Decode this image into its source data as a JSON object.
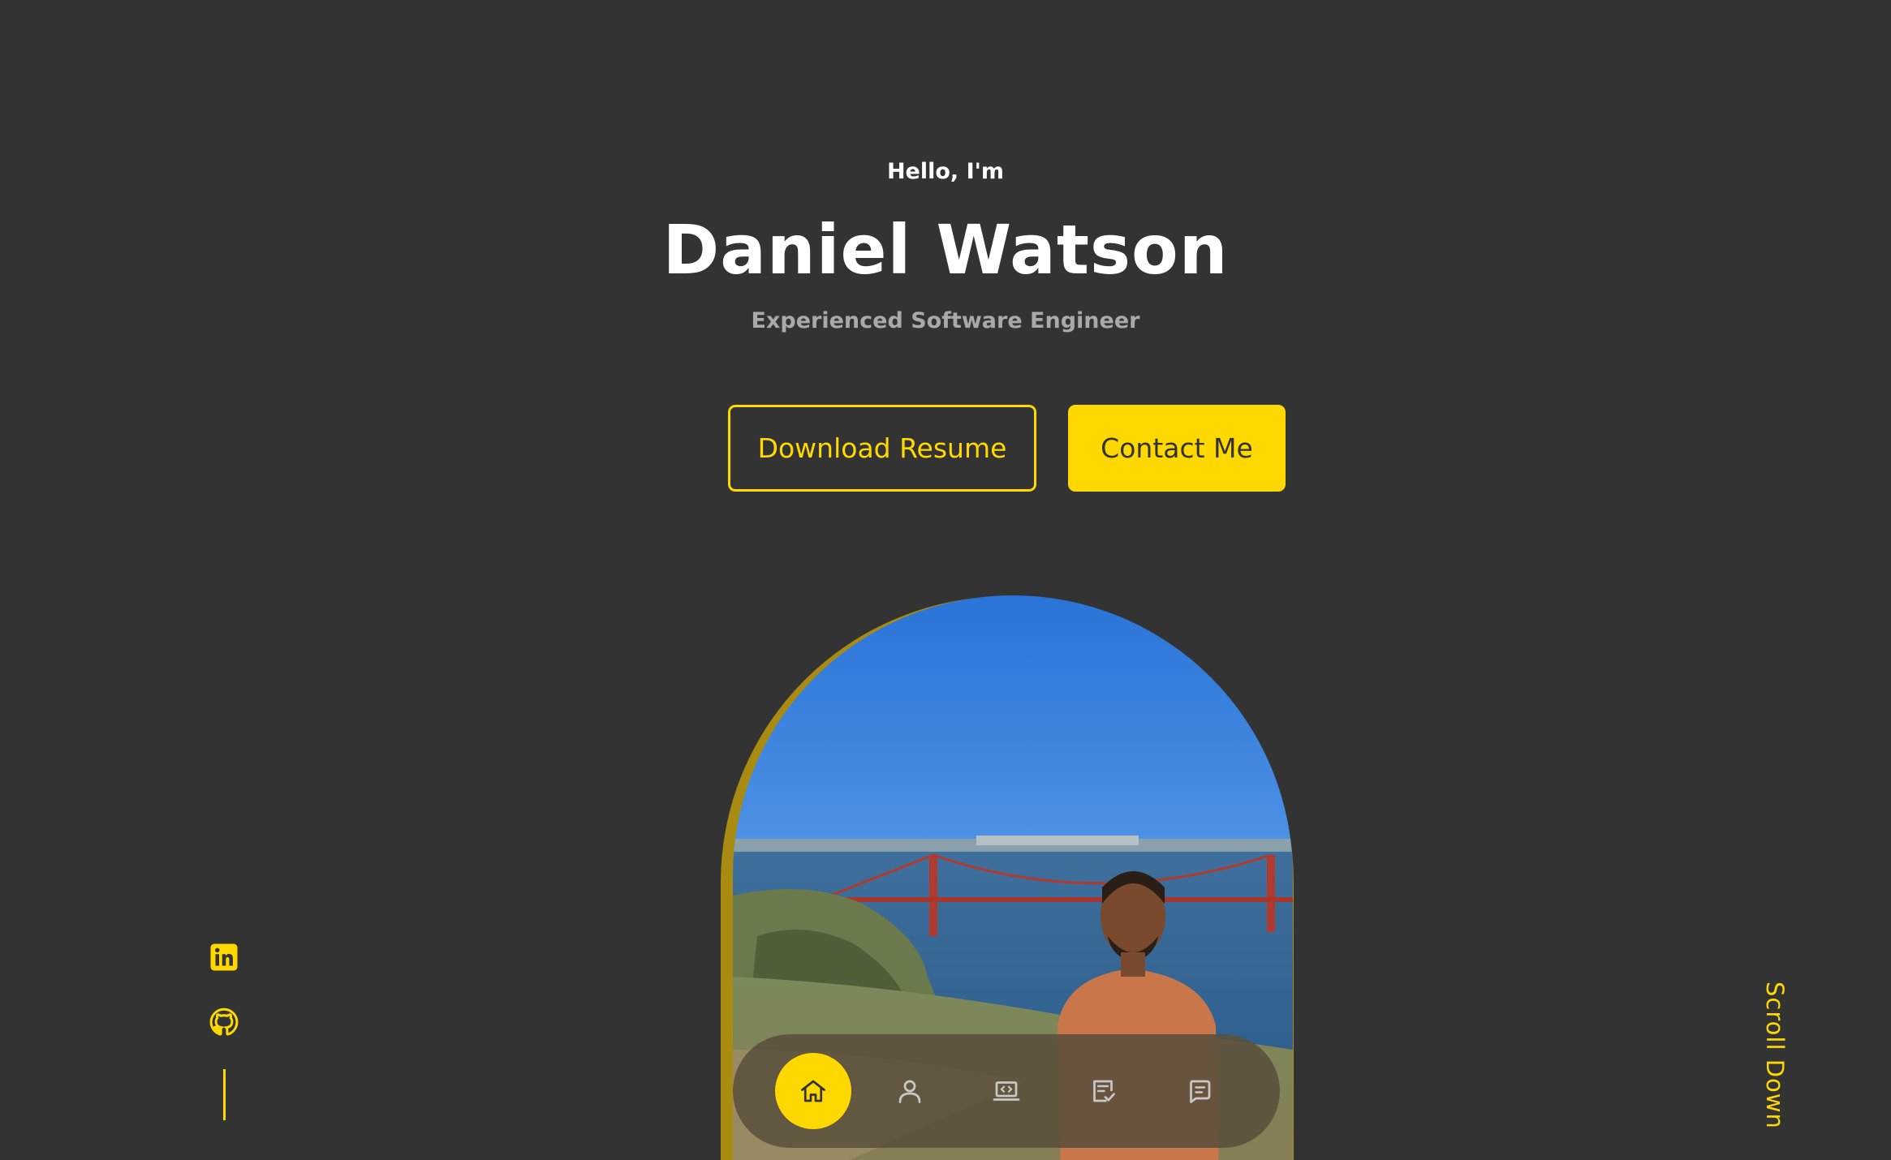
{
  "hero": {
    "greeting": "Hello, I'm",
    "name": "Daniel Watson",
    "tagline": "Experienced Software Engineer"
  },
  "buttons": {
    "download_resume": "Download Resume",
    "contact_me": "Contact Me"
  },
  "scroll_down": "Scroll Down",
  "nav": {
    "items": [
      {
        "icon": "home-icon",
        "active": true
      },
      {
        "icon": "user-icon",
        "active": false
      },
      {
        "icon": "laptop-code-icon",
        "active": false
      },
      {
        "icon": "checklist-icon",
        "active": false
      },
      {
        "icon": "message-icon",
        "active": false
      }
    ]
  },
  "socials": [
    {
      "icon": "linkedin-icon"
    },
    {
      "icon": "github-icon"
    }
  ],
  "colors": {
    "background": "#333333",
    "accent": "#ffd800",
    "text": "#ffffff",
    "muted": "#a9a9a9"
  }
}
